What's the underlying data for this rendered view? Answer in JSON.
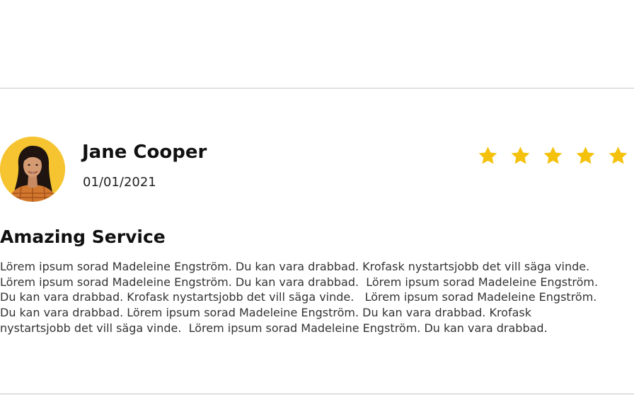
{
  "review": {
    "reviewer_name": "Jane Cooper",
    "date": "01/01/2021",
    "rating": 5,
    "rating_max": 5,
    "title": "Amazing Service",
    "body_lines": [
      "Lörem ipsum sorad Madeleine Engström. Du kan vara drabbad. Krofask nystartsjobb det vill säga vinde.",
      "Lörem ipsum sorad Madeleine Engström. Du kan vara drabbad.  Lörem ipsum sorad Madeleine Engström.",
      "Du kan vara drabbad. Krofask nystartsjobb det vill säga vinde.   Lörem ipsum sorad Madeleine Engström.",
      "Du kan vara drabbad. Lörem ipsum sorad Madeleine Engström. Du kan vara drabbad. Krofask",
      "nystartsjobb det vill säga vinde.  Lörem ipsum sorad Madeleine Engström. Du kan vara drabbad."
    ]
  },
  "icons": {
    "avatar": "avatar-photo",
    "star": "star-icon"
  },
  "colors": {
    "star": "#f4c20d",
    "avatar_background": "#f5c430",
    "divider": "#c8c8c8",
    "text": "#333333"
  }
}
